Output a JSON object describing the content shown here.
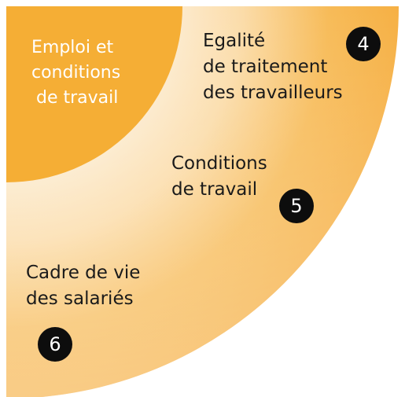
{
  "colors": {
    "inner_quadrant": "#f5ae35",
    "outer_strong": "#f6b044",
    "outer_fade": "#fef6ea"
  },
  "segments": [
    {
      "id": "inner",
      "lines": [
        "Emploi et",
        "conditions",
        "de travail"
      ]
    },
    {
      "id": "ring4",
      "number": "4",
      "lines": [
        "Egalité",
        "de traitement",
        "des travailleurs"
      ]
    },
    {
      "id": "ring5",
      "number": "5",
      "lines": [
        "Conditions",
        "de travail"
      ]
    },
    {
      "id": "ring6",
      "number": "6",
      "lines": [
        "Cadre de vie",
        "des salariés"
      ]
    }
  ]
}
